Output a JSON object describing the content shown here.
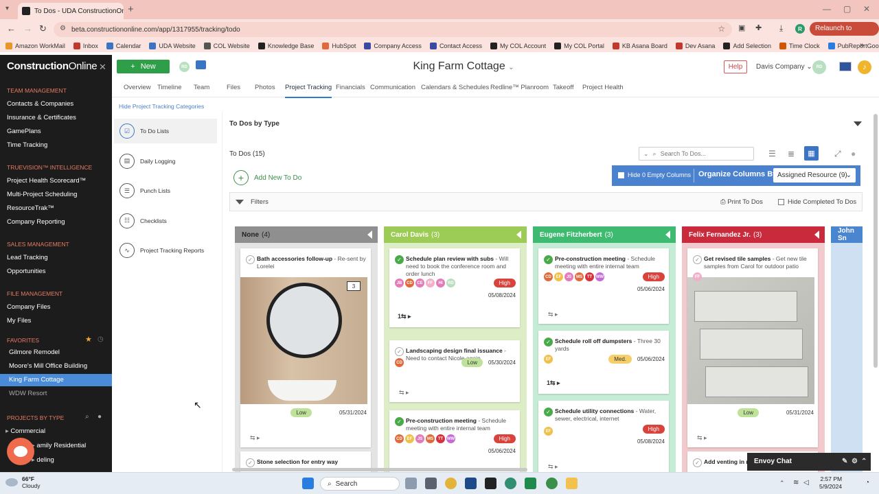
{
  "browser": {
    "tab_title": "To Dos - UDA ConstructionOnline",
    "url": "beta.constructiononline.com/app/1317955/tracking/todo",
    "relaunch": "Relaunch to update",
    "profile_initial": "R",
    "bookmarks": [
      "Amazon WorkMail",
      "Inbox",
      "Calendar",
      "UDA Website",
      "COL Website",
      "Knowledge Base",
      "HubSpot",
      "Company Access",
      "Contact Access",
      "My COL Account",
      "My COL Portal",
      "KB Asana Board",
      "Dev Asana",
      "Add Selection",
      "Time Clock",
      "PubReportGoogleDr..."
    ]
  },
  "sidebar": {
    "logo_a": "Construction",
    "logo_b": "Online",
    "sections": [
      {
        "head": "TEAM MANAGEMENT",
        "items": [
          "Contacts & Companies",
          "Insurance & Certificates",
          "GamePlans",
          "Time Tracking"
        ]
      },
      {
        "head": "TRUEVISION™ INTELLIGENCE",
        "items": [
          "Project Health Scorecard™",
          "Multi-Project Scheduling",
          "ResourceTrak™",
          "Company Reporting"
        ]
      },
      {
        "head": "SALES MANAGEMENT",
        "items": [
          "Lead Tracking",
          "Opportunities"
        ]
      },
      {
        "head": "FILE MANAGEMENT",
        "items": [
          "Company Files",
          "My Files"
        ]
      }
    ],
    "favorites_head": "FAVORITES",
    "favorites": [
      "Gilmore Remodel",
      "Moore's Mill Office Building",
      "King Farm Cottage",
      "WDW Resort"
    ],
    "projects_head": "PROJECTS BY TYPE",
    "projects": [
      "Commercial",
      "amily Residential",
      "deling"
    ]
  },
  "header": {
    "new_label": "New",
    "user_initials": "RD",
    "project_title": "King Farm Cottage",
    "help": "Help",
    "company": "Davis Company"
  },
  "topnav": [
    "Overview",
    "Timeline",
    "Team",
    "Files",
    "Photos",
    "Project Tracking",
    "Financials",
    "Communication",
    "Calendars & Schedules",
    "Redline™ Planroom",
    "Takeoff",
    "Project Health"
  ],
  "categories": {
    "hide_label": "Hide Project Tracking Categories",
    "items": [
      "To Do Lists",
      "Daily Logging",
      "Punch Lists",
      "Checklists",
      "Project Tracking Reports"
    ]
  },
  "main": {
    "section_title": "To Dos by Type",
    "todos_label": "To Dos",
    "todos_count": "(15)",
    "search_placeholder": "Search To Dos...",
    "add_todo": "Add New To Do",
    "hide_empty": "Hide 0 Empty Columns",
    "organize_label": "Organize Columns By",
    "organize_value": "Assigned Resource (9)",
    "filters": "Filters",
    "print": "Print To Dos",
    "hide_completed": "Hide Completed To Dos"
  },
  "columns": [
    {
      "name": "None",
      "count": "(4)",
      "color": "#8f8f8f",
      "body": "#e4e4e4",
      "cards": [
        {
          "title": "Bath accessories follow-up",
          "desc": " - Re-sent by Lorelei",
          "done": false,
          "priority": "Low",
          "due": "05/31/2024",
          "photo_count": "3"
        },
        {
          "title": "Stone selection for entry way",
          "desc": "",
          "done": false
        }
      ]
    },
    {
      "name": "Carol Davis",
      "count": "(3)",
      "color": "#9ccc56",
      "body": "#ddedc6",
      "cards": [
        {
          "title": "Schedule plan review with subs",
          "desc": " - Will need to book the conference room and order lunch",
          "done": true,
          "priority": "High",
          "due": "05/08/2024",
          "assignees": [
            "JB",
            "CD",
            "CE",
            "FF",
            "HI",
            "RD"
          ],
          "subtasks": "1"
        },
        {
          "title": "Landscaping design final issuance",
          "desc": " - Need to contact Nicole again",
          "done": false,
          "priority": "Low",
          "due": "05/30/2024",
          "assignees": [
            "CD"
          ]
        },
        {
          "title": "Pre-construction meeting",
          "desc": " - Schedule meeting with entire internal team",
          "done": true,
          "priority": "High",
          "due": "05/06/2024",
          "assignees": [
            "CD",
            "EF",
            "JS",
            "MS",
            "TT",
            "WW"
          ]
        }
      ]
    },
    {
      "name": "Eugene Fitzherbert",
      "count": "(3)",
      "color": "#3fbb71",
      "body": "#c7ecd6",
      "cards": [
        {
          "title": "Pre-construction meeting",
          "desc": " - Schedule meeting with entire internal team",
          "done": true,
          "priority": "High",
          "due": "05/06/2024",
          "assignees": [
            "CD",
            "EF",
            "JS",
            "MS",
            "TT",
            "WW"
          ]
        },
        {
          "title": "Schedule roll off dumpsters",
          "desc": " - Three 30 yards",
          "done": true,
          "priority": "Med.",
          "due": "05/06/2024",
          "assignees": [
            "EF"
          ],
          "subtasks": "1"
        },
        {
          "title": "Schedule utility connections",
          "desc": " - Water, sewer, electrical, internet",
          "done": true,
          "priority": "High",
          "due": "05/08/2024",
          "assignees": [
            "EF"
          ]
        }
      ]
    },
    {
      "name": "Felix Fernandez Jr.",
      "count": "(3)",
      "color": "#c92a3c",
      "body": "#f2c9cd",
      "cards": [
        {
          "title": "Get revised tile samples",
          "desc": " - Get new tile samples from Carol for outdoor patio",
          "done": false,
          "priority": "Low",
          "due": "05/31/2024",
          "assignees": [
            "FF"
          ]
        },
        {
          "title": "Add venting in m",
          "desc": "",
          "done": false
        }
      ]
    },
    {
      "name": "John Sn",
      "count": "",
      "color": "#4a86cf",
      "body": "#cfe0f3",
      "cards": []
    }
  ],
  "envoy": "Envoy Chat",
  "taskbar": {
    "temp": "66°F",
    "condition": "Cloudy",
    "search": "Search",
    "time": "2:57 PM",
    "date": "5/9/2024"
  }
}
